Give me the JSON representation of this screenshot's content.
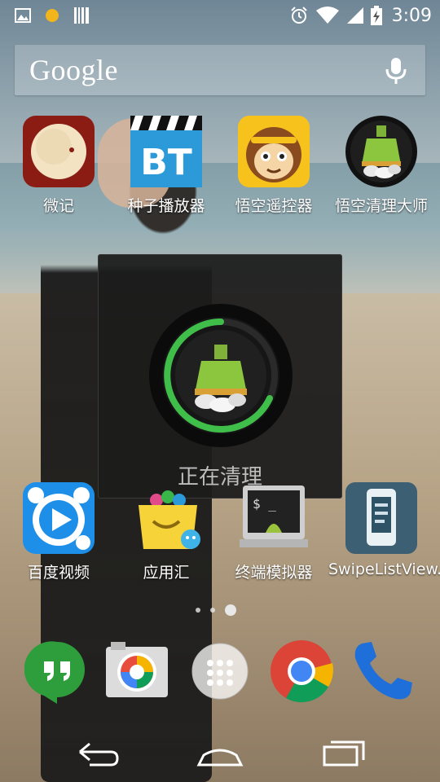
{
  "status_bar": {
    "time": "3:09",
    "icons": [
      "image-icon",
      "notification-dot-icon",
      "barcode-icon",
      "alarm-icon",
      "wifi-icon",
      "signal-icon",
      "battery-charging-icon"
    ]
  },
  "search": {
    "logo_text": "Google",
    "icon": "mic-icon"
  },
  "apps_row1": [
    {
      "label": "微记",
      "icon": "weiji-app-icon"
    },
    {
      "label": "种子播放器",
      "icon": "bt-player-icon"
    },
    {
      "label": "悟空遥控器",
      "icon": "monkey-remote-icon"
    },
    {
      "label": "悟空清理大师",
      "icon": "broom-cleaner-icon"
    }
  ],
  "dialog": {
    "text": "正在清理",
    "icon": "broom-cleaner-icon"
  },
  "apps_row2": [
    {
      "label": "百度视频",
      "icon": "baidu-video-icon"
    },
    {
      "label": "应用汇",
      "icon": "app-basket-icon"
    },
    {
      "label": "终端模拟器",
      "icon": "terminal-emulator-icon"
    },
    {
      "label": "SwipeListView..",
      "icon": "swipe-list-phone-icon"
    }
  ],
  "page_indicator": {
    "count": 3,
    "active_index": 2
  },
  "dock": [
    "hangouts-icon",
    "camera-icon",
    "app-drawer-icon",
    "chrome-icon",
    "phone-icon"
  ],
  "navbar": [
    "back-icon",
    "home-icon",
    "recents-icon"
  ],
  "colors": {
    "dialog_bg": "#1c1c1c",
    "progress_green": "#3fbf4a",
    "broom_green": "#8cc63e"
  }
}
